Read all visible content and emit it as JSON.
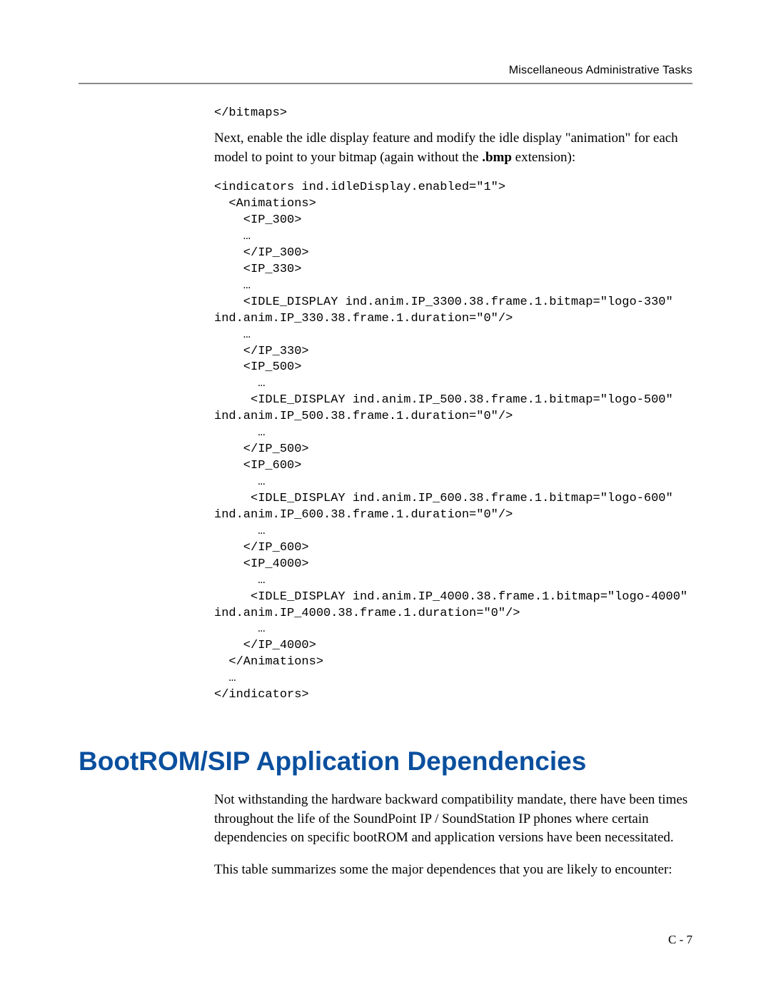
{
  "header": {
    "running": "Miscellaneous Administrative Tasks"
  },
  "code": {
    "close_bitmaps": "</bitmaps>"
  },
  "intro": {
    "text_pre": "Next, enable the idle display feature and modify the idle display \"animation\" for each model to point to your bitmap (again without the ",
    "bmp": ".bmp",
    "text_post": " extension):"
  },
  "xml": {
    "block": "<indicators ind.idleDisplay.enabled=\"1\">\n  <Animations>\n    <IP_300>\n    …\n    </IP_300>\n    <IP_330>\n    …\n    <IDLE_DISPLAY ind.anim.IP_3300.38.frame.1.bitmap=\"logo-330\" \nind.anim.IP_330.38.frame.1.duration=\"0\"/>\n    …\n    </IP_330>\n    <IP_500>\n      …\n     <IDLE_DISPLAY ind.anim.IP_500.38.frame.1.bitmap=\"logo-500\" \nind.anim.IP_500.38.frame.1.duration=\"0\"/>\n      …\n    </IP_500>\n    <IP_600>\n      …\n     <IDLE_DISPLAY ind.anim.IP_600.38.frame.1.bitmap=\"logo-600\" \nind.anim.IP_600.38.frame.1.duration=\"0\"/>\n      …\n    </IP_600>\n    <IP_4000>\n      …\n     <IDLE_DISPLAY ind.anim.IP_4000.38.frame.1.bitmap=\"logo-4000\" \nind.anim.IP_4000.38.frame.1.duration=\"0\"/>\n      …\n    </IP_4000>\n  </Animations>\n  …\n</indicators>"
  },
  "section": {
    "title": "BootROM/SIP Application Dependencies",
    "p1": "Not withstanding the hardware backward compatibility mandate, there have been times throughout the life of the SoundPoint IP / SoundStation IP phones where certain dependencies on specific bootROM and application versions have been necessitated.",
    "p2": "This table summarizes some the major dependences that you are likely to encounter:"
  },
  "footer": {
    "page": "C - 7"
  }
}
